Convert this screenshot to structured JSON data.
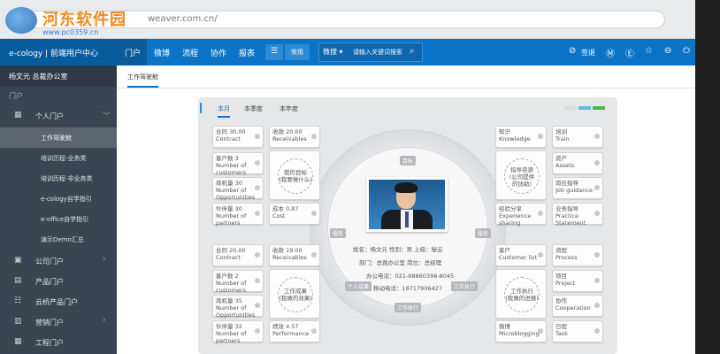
{
  "browser": {
    "url": "weaver.com.cn/"
  },
  "watermark": {
    "title": "河东软件园",
    "subtitle": "www.pc0359.cn"
  },
  "brand": "e-cology | 前端用户中心",
  "topnav": {
    "items": [
      "门户",
      "微博",
      "流程",
      "协作",
      "报表"
    ],
    "often": "常用",
    "search_select": "微搜",
    "search_placeholder": "请输入关键词搜索",
    "sign": "签退",
    "icons": [
      "check-circle-icon",
      "m-icon",
      "yen-icon",
      "star-icon",
      "minus-circle-icon",
      "power-icon"
    ]
  },
  "subbar": "杨文元 总裁办公室",
  "sidebar": {
    "header": "门户",
    "items": [
      {
        "label": "个人门户"
      },
      {
        "label": "公司门户"
      },
      {
        "label": "产品门户"
      },
      {
        "label": "云桥产品门户"
      },
      {
        "label": "营销门户"
      },
      {
        "label": "工程门户"
      }
    ],
    "subitems": [
      "工作驾驶舱",
      "培训历程-业务类",
      "培训历程-非业务类",
      "e-cology自学指引",
      "e-office自学指引",
      "演示Demo汇总"
    ]
  },
  "tabs": {
    "active": "工作驾驶舱"
  },
  "panel": {
    "tabs": [
      "本月",
      "本季度",
      "本年度"
    ],
    "swatches": [
      "#d9dbdd",
      "#5bc0de",
      "#4cb84c"
    ],
    "left_top": [
      [
        "合同 30.00",
        "Contract"
      ],
      [
        "收款 20.00",
        "Receivables"
      ],
      [
        "客户数 3",
        "Number of",
        "customers"
      ],
      [
        "商机量 30",
        "Number of",
        "Opportunities"
      ],
      [
        "伙伴量 30",
        "Number of",
        "partners"
      ],
      [
        "成本 0.87",
        "Cost"
      ]
    ],
    "left_top_goal": [
      "我的目标",
      "(我要做什么)"
    ],
    "right_top": [
      [
        "知识",
        "Knowledge"
      ],
      [
        "培训",
        "Train"
      ],
      [
        "资产",
        "Assets"
      ],
      [
        "岗位指导",
        "Job guidance"
      ],
      [
        "经验分享",
        "Experience",
        "sharing"
      ],
      [
        "业务指导",
        "Practice",
        "Statement"
      ]
    ],
    "right_top_guide": [
      "指导资源",
      "(公司提供",
      "的协助)"
    ],
    "left_bottom": [
      [
        "合同 20.00",
        "Contract"
      ],
      [
        "收款 19.00",
        "Receivables"
      ],
      [
        "客户数 2",
        "Number of",
        "customers"
      ],
      [
        "商机量 35",
        "Number of",
        "Opportunities"
      ],
      [
        "伙伴量 32",
        "Number of",
        "partners"
      ],
      [
        "绩效 4.57",
        "Performance"
      ]
    ],
    "left_bottom_result": [
      "工作成果",
      "(我做的效果)"
    ],
    "right_bottom": [
      [
        "客户",
        "Customer list"
      ],
      [
        "流程",
        "Process"
      ],
      [
        "项目",
        "Project"
      ],
      [
        "协作",
        "Cooperation"
      ],
      [
        "微博",
        "Microblogging"
      ],
      [
        "日程",
        "Task"
      ]
    ],
    "right_bottom_exec": [
      "工作执行",
      "(我做的进展)"
    ],
    "ring_labels": {
      "top": "目标",
      "left": "服务",
      "right": "服务",
      "bl": "个人成果",
      "br": "工作执行",
      "bottom": "工作执行"
    },
    "profile": {
      "line1": "姓名：杨文元   性别：男   上级：秘云",
      "line2": "部门：总裁办公室     岗位：总经理",
      "line3": "办公电话：021-68860398-8045",
      "line4": "移动电话：18717906427"
    }
  }
}
